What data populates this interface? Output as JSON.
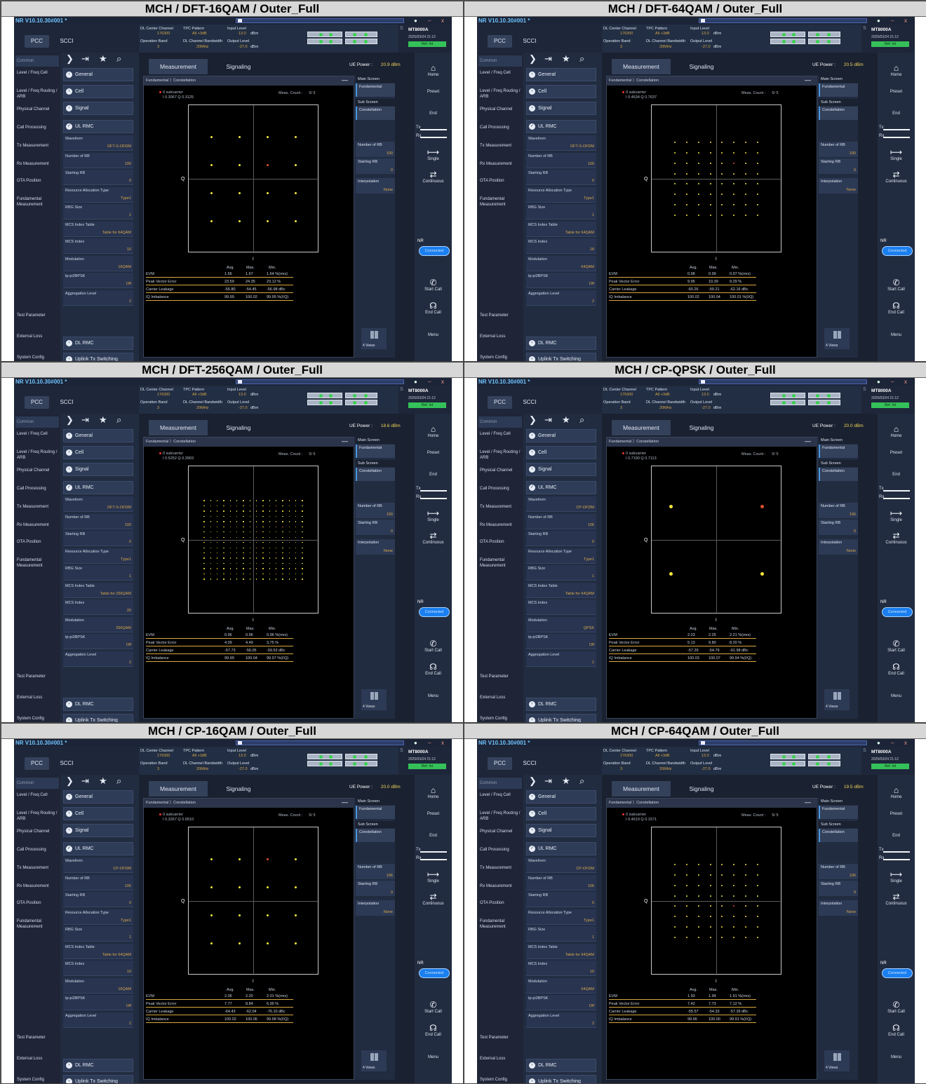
{
  "common": {
    "app_title": "NR V10.10.30#001 *",
    "tabs": [
      "PCC",
      "SCCI"
    ],
    "info": {
      "dl_center_channel_label": "DL Center Channel",
      "dl_center_channel_value": "176300",
      "tpc_pattern_label": "TPC Pattern",
      "tpc_pattern_value": "All +3dB",
      "input_level_label": "Input Level",
      "input_level_value": "13.0",
      "input_level_unit": "dBm",
      "operation_band_label": "Operation Band",
      "operation_band_value": "3",
      "dl_bandwidth_label": "DL Channel Bandwidth",
      "dl_bandwidth_value": "20MHz",
      "output_level_label": "Output Level",
      "output_level_value": "-27.0",
      "output_level_unit": "dBm"
    },
    "brand": {
      "name": "MT8000A",
      "date": "2025/03/24 21:12",
      "ref": "Ref. Int",
      "s": "S"
    },
    "left_nav": [
      "Common",
      "Level / Freq Cell",
      "Level / Freq Routing / ARB",
      "Physical Channel",
      "Call Processing",
      "Tx Measurement",
      "Rx Measurement",
      "OTA Position",
      "Fundamental Measurement",
      "Test Parameter",
      "External Loss",
      "System Config"
    ],
    "mid_buttons": [
      "General",
      "Cell",
      "Signal",
      "UL RMC",
      "DL RMC",
      "Uplink Tx Switching"
    ],
    "param_labels": [
      "Waveform",
      "Number of RB",
      "Starting RB",
      "Resource Allocation Type",
      "RBG Size",
      "MCS Index Table",
      "MCS Index",
      "Modulation",
      "tp-pi2BPSK",
      "Aggregation Level"
    ],
    "tabs_main": [
      "Measurement",
      "Signaling"
    ],
    "ue_power_label": "UE Power :",
    "breadcrumb": "Fundamental 〉Constellation",
    "marker_label": "0 subcarrier",
    "meas_count_label": "Meas. Count :",
    "axis_q": "Q",
    "axis_i": "I",
    "stats_headers": [
      "Avg.",
      "Max.",
      "Min."
    ],
    "stats_rows": [
      "EVM",
      "Peak Vector Error",
      "Carrier Leakage",
      "IQ Imbalance"
    ],
    "right_panel": {
      "main_screen": "Main Screen",
      "fundamental": "Fundamental",
      "sub_screen": "Sub Screen",
      "constellation": "Constellation",
      "number_of_rb": "Number of RB",
      "starting_rb": "Starting RB",
      "starting_rb_value": "0",
      "interpolation": "Interpolation",
      "interpolation_value": "None",
      "views": "4 Views"
    },
    "right_bar": {
      "home": "Home",
      "preset": "Preset",
      "end": "End",
      "tx": "Tx",
      "rx": "Rx",
      "single": "Single",
      "continuous": "Continuous",
      "nr": "NR",
      "connected": "Connected",
      "start_call": "Start Call",
      "end_call": "End Call",
      "menu": "Menu"
    }
  },
  "panels": [
    {
      "title": "MCH / DFT-16QAM / Outer_Full",
      "ue_power": "20.9 dBm",
      "marker_value": "I 0.3067 Q 0.3125",
      "meas_count": "5/   5",
      "params": [
        "DFT-S-OFDM",
        "100",
        "0",
        "Type1",
        "1",
        "Table for 64QAM",
        "10",
        "16QAM",
        "Off",
        "2"
      ],
      "number_of_rb_value": "100",
      "constellation": {
        "modulation": "16QAM",
        "grid": 4,
        "highlight": [
          1,
          2
        ]
      },
      "stats": [
        [
          "1.66",
          "1.67",
          "1.64 %(rms)"
        ],
        [
          "23.59",
          "24.35",
          "23.12 %"
        ],
        [
          "-55.80",
          "-54.45",
          "-56.98 dBc"
        ],
        [
          "99.99",
          "100.02",
          "99.95 %(I/Q)"
        ]
      ]
    },
    {
      "title": "MCH / DFT-64QAM / Outer_Full",
      "ue_power": "20.5 dBm",
      "marker_value": "I 0.4634 Q 0.7637",
      "meas_count": "5/   5",
      "params": [
        "DFT-S-OFDM",
        "100",
        "0",
        "Type1",
        "1",
        "Table for 64QAM",
        "18",
        "64QAM",
        "Off",
        "2"
      ],
      "number_of_rb_value": "100",
      "constellation": {
        "modulation": "64QAM",
        "grid": 8,
        "highlight": [
          2,
          5
        ]
      },
      "stats": [
        [
          "0.98",
          "0.99",
          "0.97 %(rms)"
        ],
        [
          "9.95",
          "10.39",
          "9.29 %"
        ],
        [
          "-60.26",
          "-59.21",
          "-62.16 dBc"
        ],
        [
          "100.02",
          "100.04",
          "100.01 %(I/Q)"
        ]
      ]
    },
    {
      "title": "MCH / DFT-256QAM / Outer_Full",
      "ue_power": "18.6 dBm",
      "marker_value": "I 0.5252 Q 0.3903",
      "meas_count": "5/   5",
      "params": [
        "DFT-S-OFDM",
        "100",
        "0",
        "Type1",
        "1",
        "Table for 256QAM",
        "20",
        "256QAM",
        "Off",
        "2"
      ],
      "number_of_rb_value": "100",
      "constellation": {
        "modulation": "256QAM",
        "grid": 16,
        "highlight": [
          5,
          12
        ]
      },
      "stats": [
        [
          "0.96",
          "0.96",
          "0.96 %(rms)"
        ],
        [
          "4.09",
          "4.49",
          "3.75 %"
        ],
        [
          "-57.73",
          "-56.05",
          "-59.53 dBc"
        ],
        [
          "99.99",
          "100.04",
          "99.97 %(I/Q)"
        ]
      ]
    },
    {
      "title": "MCH / CP-QPSK / Outer_Full",
      "ue_power": "20.0 dBm",
      "marker_value": "I 0.7190 Q 0.7113",
      "meas_count": "5/   5",
      "params": [
        "CP-OFDM",
        "106",
        "0",
        "Type1",
        "1",
        "Table for 64QAM",
        "",
        "QPSK",
        "Off",
        "2"
      ],
      "number_of_rb_value": "106",
      "constellation": {
        "modulation": "QPSK",
        "grid": 2,
        "highlight": [
          0,
          1
        ]
      },
      "stats": [
        [
          "2.23",
          "2.25",
          "2.21 %(rms)"
        ],
        [
          "5.13",
          "9.80",
          "8.20 %"
        ],
        [
          "-57.29",
          "-54.79",
          "-61.98 dBc"
        ],
        [
          "100.03",
          "100.07",
          "99.94 %(I/Q)"
        ]
      ]
    },
    {
      "title": "MCH / CP-16QAM / Outer_Full",
      "ue_power": "20.0 dBm",
      "marker_value": "I 0.3267 Q 0.9510",
      "meas_count": "5/   5",
      "params": [
        "CP-OFDM",
        "106",
        "0",
        "Type1",
        "1",
        "Table for 64QAM",
        "10",
        "16QAM",
        "Off",
        "2"
      ],
      "number_of_rb_value": "106",
      "constellation": {
        "modulation": "16QAM",
        "grid": 4,
        "highlight": [
          0,
          2
        ]
      },
      "stats": [
        [
          "2.06",
          "2.20",
          "2.01 %(rms)"
        ],
        [
          "7.77",
          "8.84",
          "6.99 %"
        ],
        [
          "-64.43",
          "-62.04",
          "-76.10 dBc"
        ],
        [
          "100.02",
          "100.06",
          "99.98 %(I/Q)"
        ]
      ]
    },
    {
      "title": "MCH / CP-64QAM / Outer_Full",
      "ue_power": "19.5 dBm",
      "marker_value": "I 0.4619 Q 0.1571",
      "meas_count": "5/   5",
      "params": [
        "CP-OFDM",
        "106",
        "0",
        "Type1",
        "1",
        "Table for 64QAM",
        "19",
        "64QAM",
        "Off",
        "2"
      ],
      "number_of_rb_value": "106",
      "constellation": {
        "modulation": "64QAM",
        "grid": 8,
        "highlight": [
          4,
          5
        ]
      },
      "stats": [
        [
          "1.93",
          "1.94",
          "1.91 %(rms)"
        ],
        [
          "7.42",
          "7.73",
          "7.12 %"
        ],
        [
          "-55.57",
          "-54.33",
          "-57.39 dBc"
        ],
        [
          "99.96",
          "100.00",
          "99.91 %(I/Q)"
        ]
      ]
    }
  ],
  "colors": {
    "point": "#f5e63a",
    "highlight": "#e0502c",
    "value_text": "#d8a74c",
    "connected": "#1b7ff0"
  }
}
